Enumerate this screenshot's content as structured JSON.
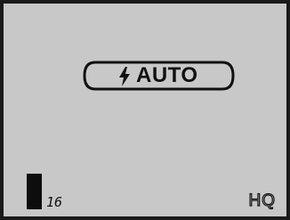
{
  "display": {
    "flash_mode": "AUTO",
    "flash_icon": "lightning-bolt-icon",
    "shots_remaining": "16",
    "quality": "HQ",
    "battery_level": 1.0,
    "colors": {
      "lcd_background": "#c8c8c8",
      "segment": "#111111",
      "frame": "#1a1a1a"
    }
  }
}
